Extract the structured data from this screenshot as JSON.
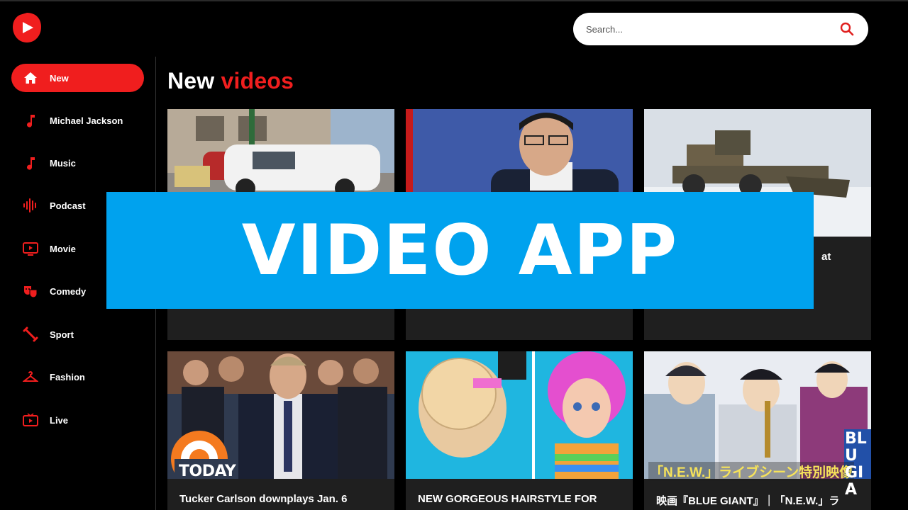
{
  "search": {
    "placeholder": "Search..."
  },
  "sidebar": {
    "items": [
      {
        "label": "New",
        "icon": "home-icon",
        "active": true
      },
      {
        "label": "Michael Jackson",
        "icon": "music-note-icon"
      },
      {
        "label": "Music",
        "icon": "music-note-icon"
      },
      {
        "label": "Podcast",
        "icon": "audio-wave-icon"
      },
      {
        "label": "Movie",
        "icon": "tv-play-icon"
      },
      {
        "label": "Comedy",
        "icon": "theater-masks-icon"
      },
      {
        "label": "Sport",
        "icon": "dumbbell-icon"
      },
      {
        "label": "Fashion",
        "icon": "hanger-icon"
      },
      {
        "label": "Live",
        "icon": "live-tv-icon"
      }
    ]
  },
  "main": {
    "heading": {
      "part1": "New",
      "part2": "videos"
    },
    "videos": [
      {
        "title": "",
        "thumb_note": "car-accident"
      },
      {
        "title": "",
        "thumb_note": "press-conference"
      },
      {
        "title": "at",
        "thumb_note": "snow-plow"
      },
      {
        "title": "Tucker Carlson downplays Jan. 6",
        "thumb_note": "news-today",
        "badge": "TODAY"
      },
      {
        "title": "NEW GORGEOUS HAIRSTYLE FOR",
        "thumb_note": "doll-hair"
      },
      {
        "title": "映画『BLUE GIANT』｜「N.E.W.」ラ",
        "thumb_note": "anime",
        "caption": "「N.E.W.」ライブシーン特別映像",
        "side_text": "BLU GIA"
      }
    ]
  },
  "overlay": {
    "banner_text": "VIDEO APP"
  },
  "colors": {
    "accent": "#f01e1e",
    "banner": "#00a2ee",
    "card": "#1f1f1f"
  }
}
